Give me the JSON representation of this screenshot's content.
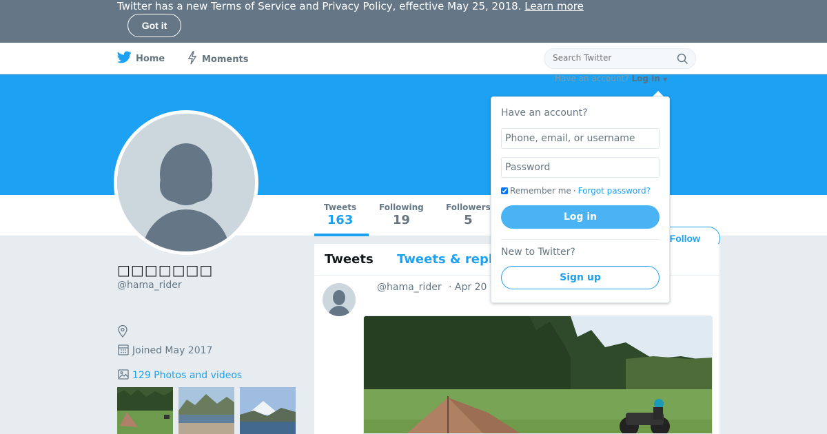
{
  "banner": {
    "text": "Twitter has a new Terms of Service and Privacy Policy, effective May 25, 2018.",
    "link": "Learn more",
    "button": "Got it"
  },
  "nav": {
    "home": "Home",
    "moments": "Moments",
    "search_placeholder": "Search Twitter",
    "have_account": "Have an account?",
    "login": "Log in"
  },
  "stats": {
    "tweets_label": "Tweets",
    "tweets_value": "163",
    "following_label": "Following",
    "following_value": "19",
    "followers_label": "Followers",
    "followers_value": "5",
    "follow_button": "Follow"
  },
  "profile": {
    "name": "□□□□□□□",
    "handle": "@hama_rider",
    "joined": "Joined May 2017",
    "photos": "129 Photos and videos"
  },
  "timeline": {
    "tab_tweets": "Tweets",
    "tab_replies": "Tweets & replies",
    "tweet_handle": "@hama_rider",
    "tweet_date": "· Apr 20"
  },
  "login_dropdown": {
    "title": "Have an account?",
    "username_placeholder": "Phone, email, or username",
    "password_placeholder": "Password",
    "remember": "Remember me",
    "separator": "·",
    "forgot": "Forgot password?",
    "login_button": "Log in",
    "new_to": "New to Twitter?",
    "signup_button": "Sign up"
  },
  "colors": {
    "brand_blue": "#1da1f2",
    "banner_gray": "#657786",
    "page_bg": "#e6ecf0"
  },
  "icons": [
    "twitter-bird-icon",
    "lightning-icon",
    "search-icon",
    "chevron-down-icon",
    "location-icon",
    "calendar-icon",
    "image-icon",
    "default-avatar-icon"
  ]
}
